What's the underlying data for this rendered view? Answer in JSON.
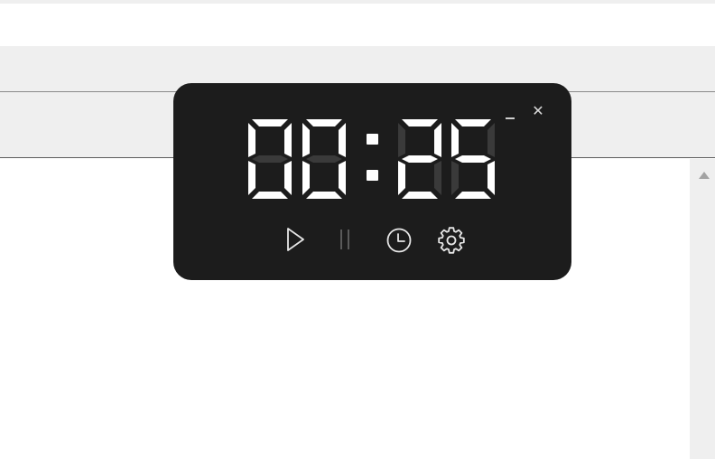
{
  "timer": {
    "time_display": "00:25",
    "minutes": "00",
    "seconds": "25",
    "digit_on_color": "#ffffff",
    "digit_off_color": "#3a3a3a",
    "background_color": "#1c1c1c"
  },
  "window_controls": {
    "minimize_icon": "minimize-icon",
    "close_label": "✕"
  },
  "controls": {
    "play_icon": "play-icon",
    "pause_icon": "pause-icon",
    "pause_enabled": false,
    "clock_icon": "clock-icon",
    "settings_icon": "gear-icon"
  }
}
